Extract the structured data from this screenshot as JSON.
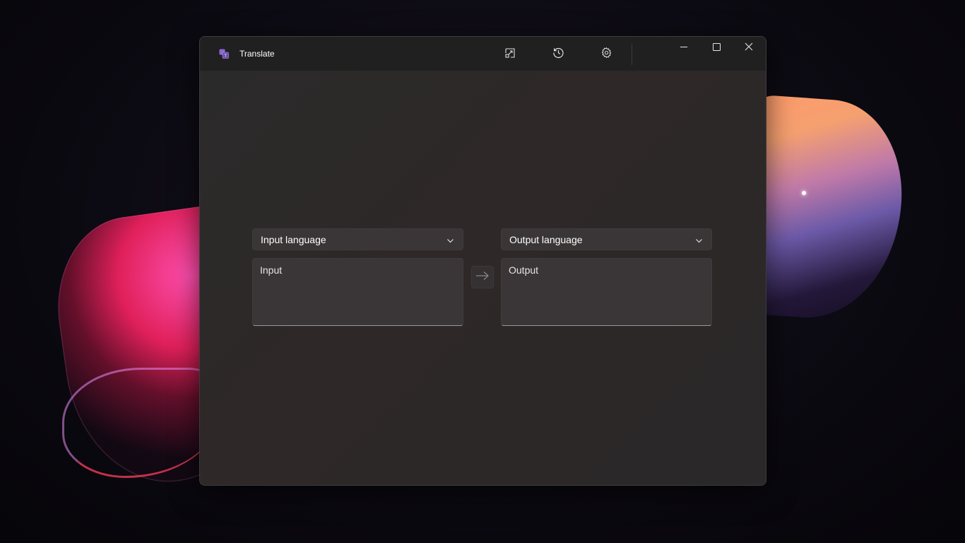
{
  "window": {
    "title": "Translate"
  },
  "toolbar": {
    "snip_icon": "screen-snip-icon",
    "history_icon": "history-icon",
    "settings_icon": "gear-icon"
  },
  "window_controls": {
    "minimize_icon": "minimize-icon",
    "maximize_icon": "maximize-icon",
    "close_icon": "close-icon"
  },
  "translator": {
    "input_language": {
      "label": "Input language"
    },
    "output_language": {
      "label": "Output language"
    },
    "input": {
      "placeholder": "Input"
    },
    "output": {
      "placeholder": "Output"
    },
    "translate_icon": "arrow-right-icon"
  },
  "colors": {
    "accent": "#7a5ac8",
    "background": "#272727"
  }
}
